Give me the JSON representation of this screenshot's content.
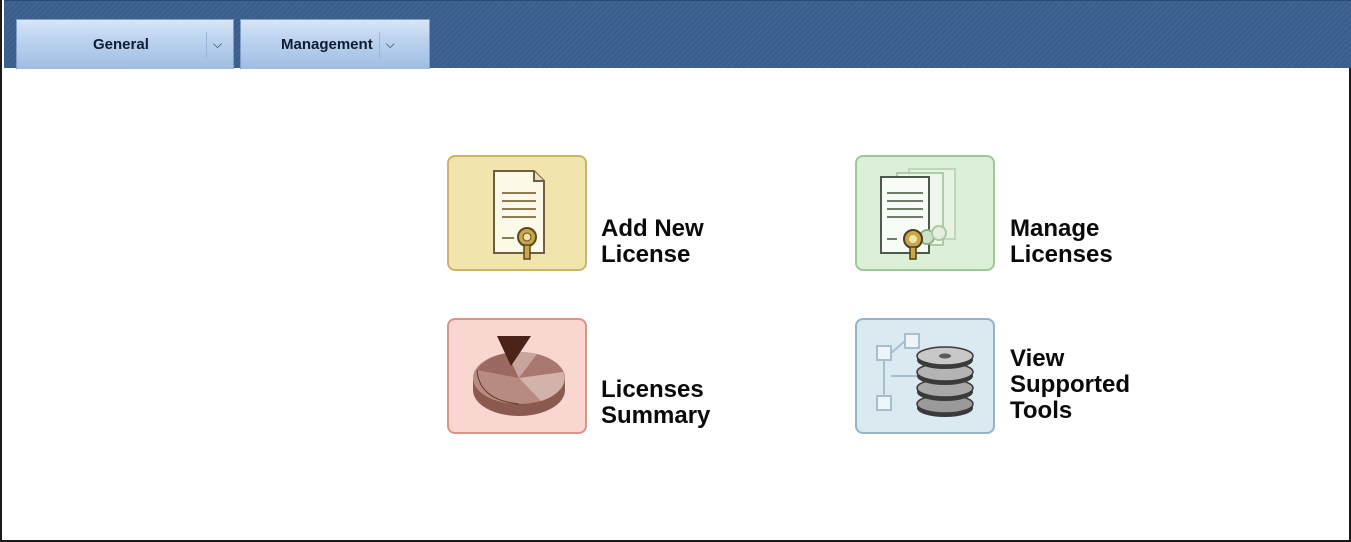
{
  "menu": {
    "general": {
      "label": "General",
      "arrow": "⌵"
    },
    "management": {
      "label": "Management",
      "arrow": "⌵"
    }
  },
  "tiles": {
    "add_license": {
      "line1": "Add New",
      "line2": "License",
      "icon": "certificate-icon",
      "color": "#f1e4ac"
    },
    "manage_licenses": {
      "line1": "Manage",
      "line2": "Licenses",
      "icon": "certificates-stack-icon",
      "color": "#dcefd8"
    },
    "licenses_summary": {
      "line1": "Licenses",
      "line2": "Summary",
      "icon": "pie-chart-icon",
      "color": "#f9d6cf"
    },
    "view_tools": {
      "line1": "View",
      "line2": "Supported",
      "line3": "Tools",
      "icon": "database-disks-icon",
      "color": "#dbe9f0"
    }
  },
  "colors": {
    "menubar": "#3a5f8f",
    "tab": "#bcd3ee"
  }
}
